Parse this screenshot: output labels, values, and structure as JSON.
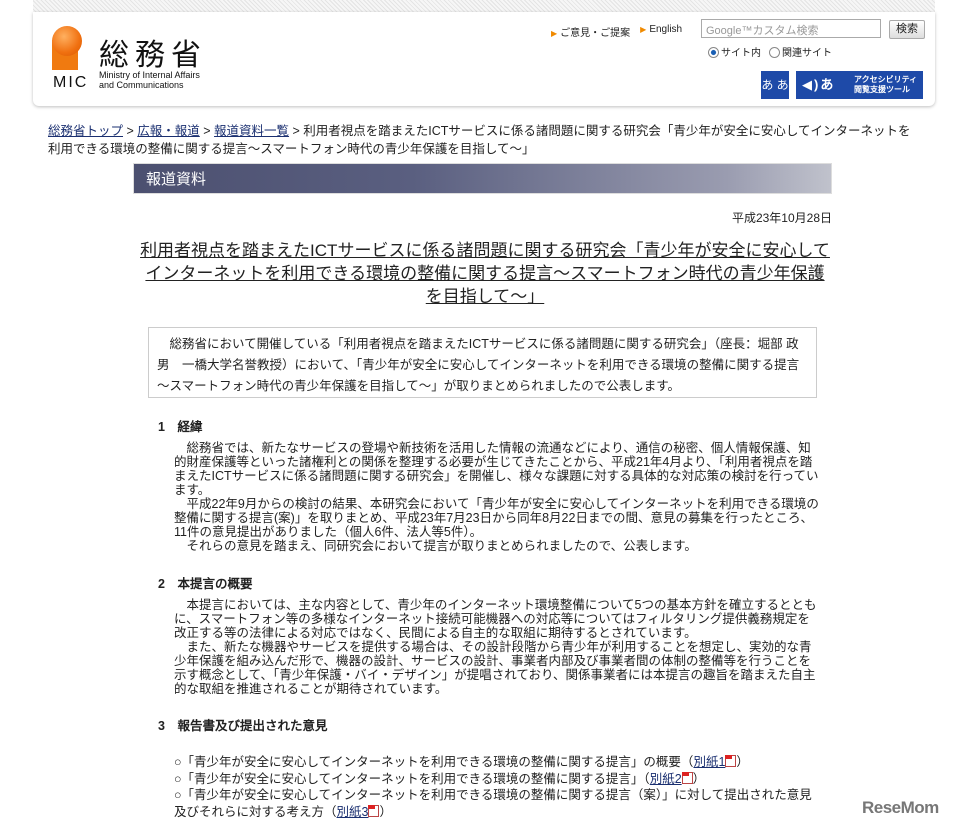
{
  "header": {
    "logo_jp": "総務省",
    "logo_abbr": "MIC",
    "logo_en": [
      "Ministry of Internal Affairs",
      "and Communications"
    ],
    "links": [
      "ご意見・ご提案",
      "English"
    ],
    "search_placeholder": "Google™カスタム検索",
    "search_button": "検索",
    "radio_options": [
      "サイト内",
      "関連サイト"
    ],
    "accessibility_text": [
      "アクセシビリティ",
      "閲覧支援ツール"
    ],
    "font_size_label": "あ あ"
  },
  "breadcrumb": {
    "items": [
      "総務省トップ",
      "広報・報道",
      "報道資料一覧"
    ],
    "current": "利用者視点を踏まえたICTサービスに係る諸問題に関する研究会「青少年が安全に安心してインターネットを利用できる環境の整備に関する提言～スマートフォン時代の青少年保護を目指して～」"
  },
  "press_bar": "報道資料",
  "date": "平成23年10月28日",
  "title": "利用者視点を踏まえたICTサービスに係る諸問題に関する研究会「青少年が安全に安心してインターネットを利用できる環境の整備に関する提言～スマートフォン時代の青少年保護を目指して～」",
  "summary": "総務省において開催している「利用者視点を踏まえたICTサービスに係る諸問題に関する研究会」（座長：堀部 政男　一橋大学名誉教授）において、「青少年が安全に安心してインターネットを利用できる環境の整備に関する提言～スマートフォン時代の青少年保護を目指して～」が取りまとめられましたので公表します。",
  "sections": [
    {
      "heading": "1　経緯",
      "paragraphs": [
        "総務省では、新たなサービスの登場や新技術を活用した情報の流通などにより、通信の秘密、個人情報保護、知的財産保護等といった諸権利との関係を整理する必要が生じてきたことから、平成21年4月より、「利用者視点を踏まえたICTサービスに係る諸問題に関する研究会」を開催し、様々な課題に対する具体的な対応策の検討を行っています。",
        "平成22年9月からの検討の結果、本研究会において「青少年が安全に安心してインターネットを利用できる環境の整備に関する提言(案)」を取りまとめ、平成23年7月23日から同年8月22日までの間、意見の募集を行ったところ、11件の意見提出がありました（個人6件、法人等5件）。",
        "それらの意見を踏まえ、同研究会において提言が取りまとめられましたので、公表します。"
      ]
    },
    {
      "heading": "2　本提言の概要",
      "paragraphs": [
        "本提言においては、主な内容として、青少年のインターネット環境整備について5つの基本方針を確立するとともに、スマートフォン等の多様なインターネット接続可能機器への対応等についてはフィルタリング提供義務規定を改正する等の法律による対応ではなく、民間による自主的な取組に期待するとされています。",
        "また、新たな機器やサービスを提供する場合は、その設計段階から青少年が利用することを想定し、実効的な青少年保護を組み込んだ形で、機器の設計、サービスの設計、事業者内部及び事業者間の体制の整備等を行うことを示す概念として、「青少年保護・バイ・デザイン」が提唱されており、関係事業者には本提言の趣旨を踏まえた自主的な取組を推進されることが期待されています。"
      ]
    },
    {
      "heading": "3　報告書及び提出された意見",
      "items": [
        {
          "text": "○「青少年が安全に安心してインターネットを利用できる環境の整備に関する提言」の概要（",
          "link": "別紙1",
          "after": "）"
        },
        {
          "text": "○「青少年が安全に安心してインターネットを利用できる環境の整備に関する提言」（",
          "link": "別紙2",
          "after": "）"
        },
        {
          "text": "○「青少年が安全に安心してインターネットを利用できる環境の整備に関する提言（案）」に対して提出された意見及びそれらに対する考え方（",
          "link": "別紙3",
          "after": "）"
        }
      ]
    }
  ],
  "watermark": "ReseMom"
}
